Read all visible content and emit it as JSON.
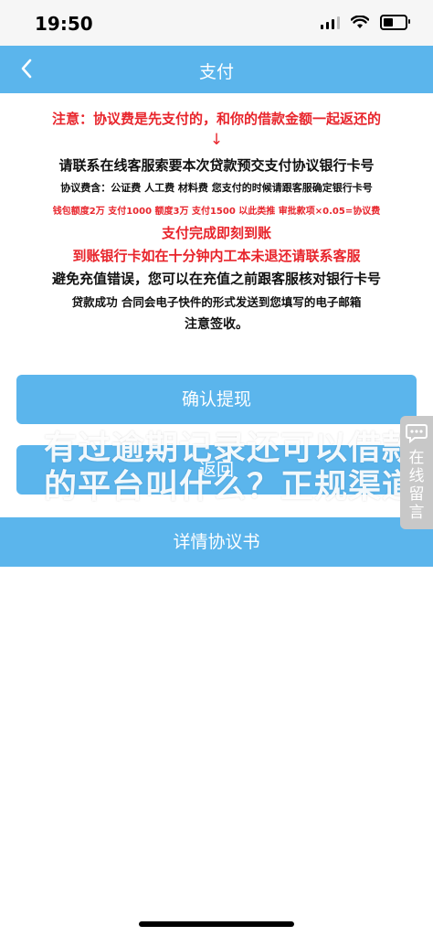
{
  "status_bar": {
    "time": "19:50"
  },
  "nav": {
    "title": "支付"
  },
  "notice": {
    "line1": "注意：协议费是先支付的，和你的借款金额一起返还的",
    "arrow": "↓",
    "line2": "请联系在线客服索要本次贷款预交支付协议银行卡号",
    "line3": "协议费含：公证费 人工费 材料费 您支付的时候请跟客服确定银行卡号",
    "line4": "钱包额度2万 支付1000  额度3万 支付1500 以此类推 审批款项×0.05=协议费",
    "line5": "支付完成即刻到账",
    "line6": "到账银行卡如在十分钟内工本未退还请联系客服",
    "line7": "避免充值错误，您可以在充值之前跟客服核对银行卡号",
    "line8": "贷款成功 合同会电子快件的形式发送到您填写的电子邮箱",
    "line9": "注意签收。"
  },
  "buttons": {
    "confirm": "确认提现",
    "back": "返回",
    "agreement": "详情协议书"
  },
  "watermark": {
    "line1": "有过逾期记录还可以借款",
    "line2": "的平台叫什么？正规渠道"
  },
  "float_chat": {
    "label": "在线留言"
  },
  "colors": {
    "accent": "#5bb5ec",
    "warning": "#e8252c"
  }
}
